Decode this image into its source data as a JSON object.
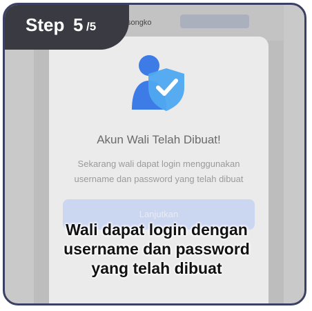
{
  "step": {
    "word": "Step",
    "current": "5",
    "total": "/5"
  },
  "appbar": {
    "text": "songko"
  },
  "dialog": {
    "title": "Akun Wali Telah Dibuat!",
    "description": "Sekarang wali dapat login menggunakan username dan password yang telah dibuat",
    "button_label": "Lanjutkan",
    "icon": "user-shield-check-icon"
  },
  "caption": {
    "line1": "Wali dapat login dengan",
    "line2": "username dan password",
    "line3": "yang telah dibuat"
  },
  "colors": {
    "frame_border": "#3a3f63",
    "badge_bg": "#3a3a42",
    "icon_blue": "#3d7be6",
    "icon_shield": "#4fa8f0",
    "button_bg": "#cbd6f0"
  }
}
